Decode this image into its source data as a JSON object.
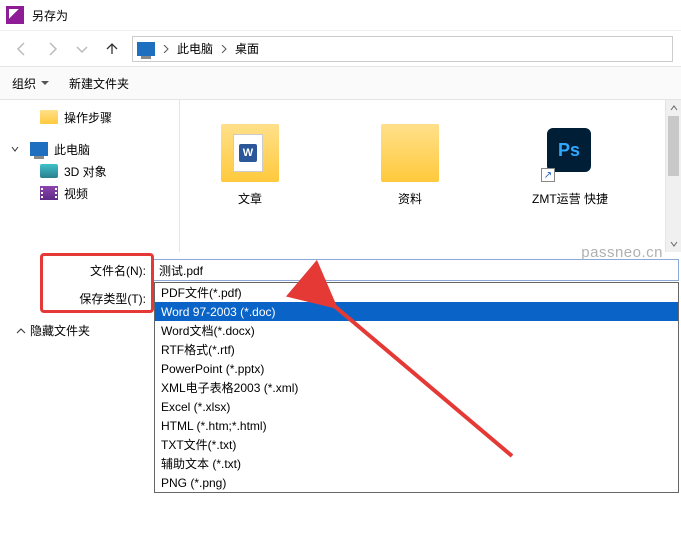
{
  "window": {
    "title": "另存为"
  },
  "breadcrumb": {
    "root": "此电脑",
    "folder": "桌面"
  },
  "toolbar": {
    "organize": "组织",
    "new_folder": "新建文件夹"
  },
  "sidebar": {
    "steps": "操作步骤",
    "this_pc": "此电脑",
    "three_d": "3D 对象",
    "video": "视频"
  },
  "files": {
    "f1": "文章",
    "f2": "资料",
    "f3": "ZMT运营 快捷"
  },
  "watermark": "passneo.cn",
  "form": {
    "filename_label": "文件名(N):",
    "filename_value": "测试.pdf",
    "type_label": "保存类型(T):",
    "type_value": "PDF文件(*.pdf)"
  },
  "hide_folders": "隐藏文件夹",
  "type_options": [
    "PDF文件(*.pdf)",
    "Word 97-2003 (*.doc)",
    "Word文档(*.docx)",
    "RTF格式(*.rtf)",
    "PowerPoint (*.pptx)",
    "XML电子表格2003 (*.xml)",
    "Excel (*.xlsx)",
    "HTML (*.htm;*.html)",
    "TXT文件(*.txt)",
    "辅助文本 (*.txt)",
    "PNG (*.png)"
  ],
  "selected_index": 1
}
